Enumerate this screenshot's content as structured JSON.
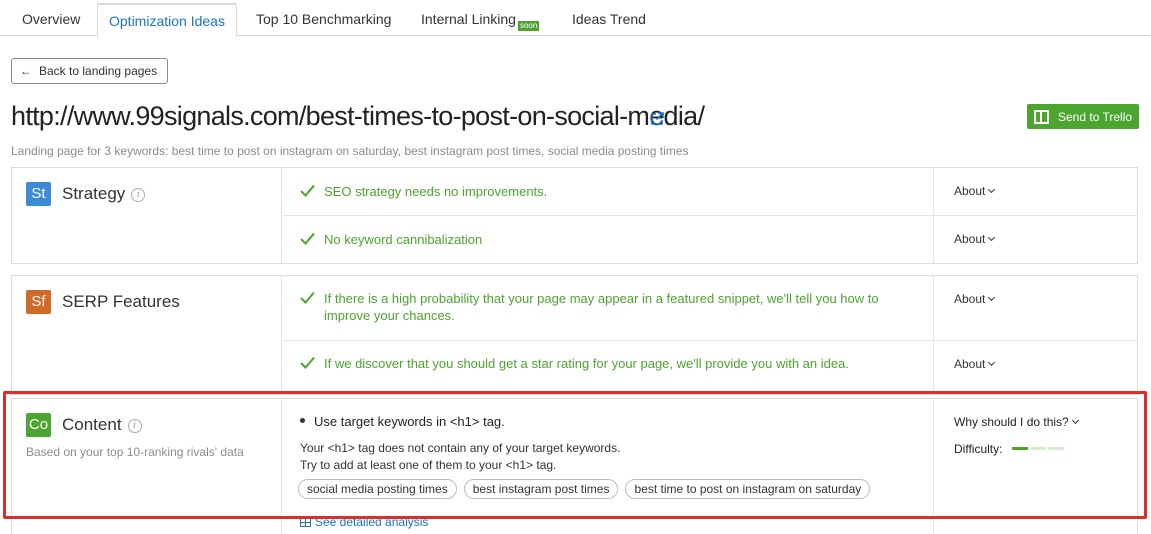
{
  "tabs": [
    {
      "label": "Overview"
    },
    {
      "label": "Optimization Ideas"
    },
    {
      "label": "Top 10 Benchmarking"
    },
    {
      "label": "Internal Linking",
      "badge": "soon"
    },
    {
      "label": "Ideas Trend"
    }
  ],
  "back_button": {
    "label": "Back to landing pages"
  },
  "page": {
    "url": "http://www.99signals.com/best-times-to-post-on-social-media/",
    "subtitle": "Landing page for 3 keywords: best time to post on instagram on saturday, best instagram post times, social media posting times",
    "trello_label": "Send to Trello"
  },
  "sections": {
    "strategy": {
      "icon": "St",
      "title": "Strategy",
      "ideas": [
        {
          "text": "SEO strategy needs no improvements.",
          "about": "About"
        },
        {
          "text": "No keyword cannibalization",
          "about": "About"
        }
      ]
    },
    "serp": {
      "icon": "Sf",
      "title": "SERP Features",
      "ideas": [
        {
          "text": "If there is a high probability that your page may appear in a featured snippet, we'll tell you how to improve your chances.",
          "about": "About"
        },
        {
          "text": "If we discover that you should get a star rating for your page, we'll provide you with an idea.",
          "about": "About"
        }
      ]
    },
    "content": {
      "icon": "Co",
      "title": "Content",
      "note": "Based on your top 10-ranking rivals' data",
      "idea_title": "Use target keywords in <h1> tag.",
      "desc_line1": "Your <h1> tag does not contain any of your target keywords.",
      "desc_line2": "Try to add at least one of them to your <h1> tag.",
      "keywords": [
        "social media posting times",
        "best instagram post times",
        "best time to post on instagram on saturday"
      ],
      "detailed_link": "See detailed analysis",
      "why_label": "Why should I do this?",
      "difficulty_label": "Difficulty:",
      "difficulty_level": 1,
      "difficulty_max": 3
    }
  },
  "colors": {
    "accent_blue": "#1a73c6",
    "success_green": "#4ca52f",
    "strategy_icon": "#3d8bd4",
    "serp_icon": "#d06a2b",
    "content_icon": "#4ca52f",
    "highlight_red": "#d9302c"
  }
}
